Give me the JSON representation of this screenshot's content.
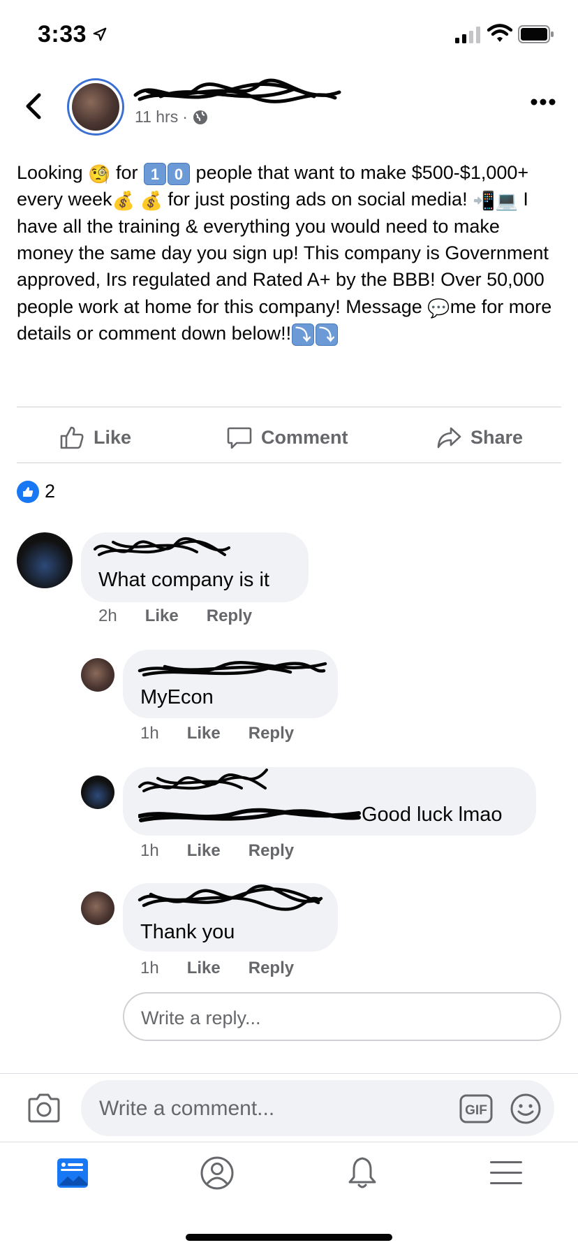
{
  "status_bar": {
    "time": "3:33",
    "icons": [
      "location-arrow-icon",
      "cellular-signal-icon",
      "wifi-icon",
      "battery-icon"
    ]
  },
  "post": {
    "time": "11 hrs",
    "separator": "·",
    "privacy_icon": "globe-icon",
    "body": {
      "p1": "Looking",
      "p2": "for",
      "keycap1": "1",
      "keycap2": "0",
      "p3": "people that want to make $500-$1,000+ every week",
      "p4": "for just posting ads on social media!",
      "p5": "I have all the training & everything you would need to make money the same day you sign up! This company is Government approved, Irs regulated and  Rated A+ by the BBB! Over 50,000 people work at home for this company! Message",
      "p6": "me for more details or comment down below!!"
    },
    "emoji": {
      "monocle": "🧐",
      "money_bag": "💰",
      "phone": "📲",
      "laptop": "💻",
      "speech": "💬",
      "down_arrow": "⤵"
    }
  },
  "actions": {
    "like": "Like",
    "comment": "Comment",
    "share": "Share"
  },
  "reactions": {
    "count": "2"
  },
  "comments": [
    {
      "text": "What company is it",
      "time": "2h",
      "like": "Like",
      "reply": "Reply"
    },
    {
      "text": "MyEcon",
      "time": "1h",
      "like": "Like",
      "reply": "Reply"
    },
    {
      "text": "Good luck lmao",
      "time": "1h",
      "like": "Like",
      "reply": "Reply"
    },
    {
      "text": "Thank you",
      "time": "1h",
      "like": "Like",
      "reply": "Reply"
    }
  ],
  "reply_box": {
    "placeholder": "Write a reply..."
  },
  "composer": {
    "placeholder": "Write a comment...",
    "gif_label": "GIF"
  },
  "colors": {
    "accent": "#1877f2",
    "muted": "#65676b",
    "bubble": "#f0f2f5",
    "avatar_ring": "#3b6fd4"
  },
  "tab_bar": {
    "icons": [
      "news-feed-icon",
      "profile-icon",
      "notifications-bell-icon",
      "menu-icon"
    ]
  }
}
